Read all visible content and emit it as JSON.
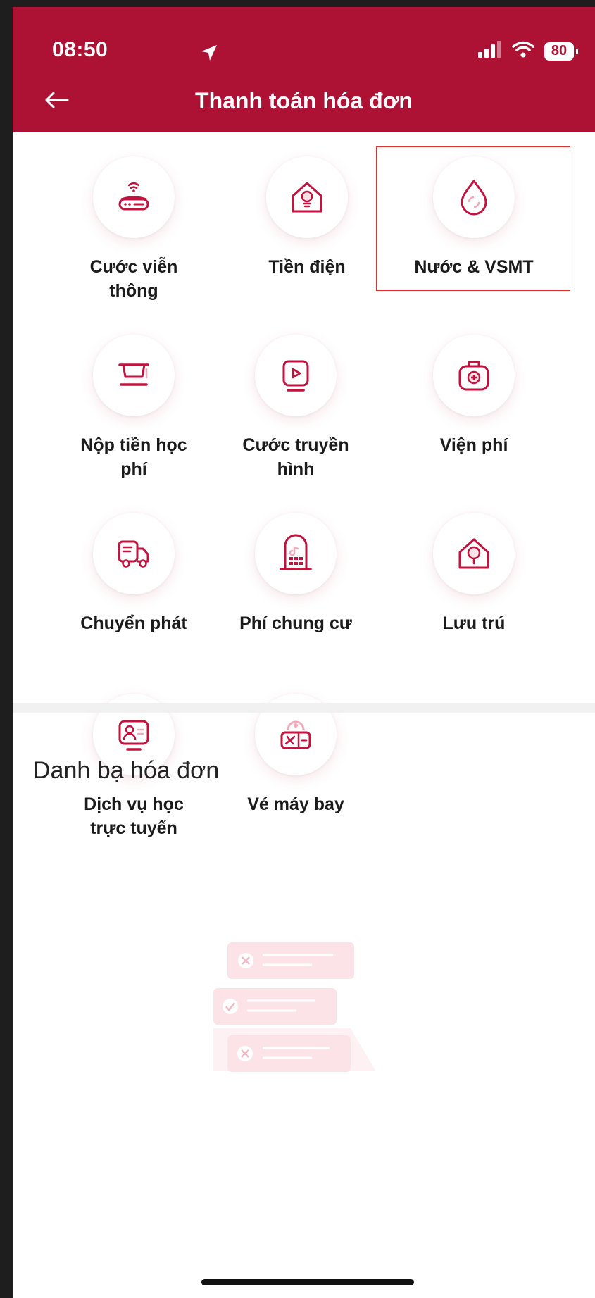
{
  "status_bar": {
    "time": "08:50",
    "battery": "80"
  },
  "header": {
    "title": "Thanh toán hóa đơn"
  },
  "services": [
    {
      "label_line1": "Cước viễn",
      "label_line2": "thông",
      "icon": "router-icon"
    },
    {
      "label_line1": "Tiền điện",
      "label_line2": "",
      "icon": "lightbulb-house-icon"
    },
    {
      "label_line1": "Nước & VSMT",
      "label_line2": "",
      "icon": "water-drop-icon"
    },
    {
      "label_line1": "Nộp tiền học",
      "label_line2": "phí",
      "icon": "graduation-cap-icon"
    },
    {
      "label_line1": "Cước truyền",
      "label_line2": "hình",
      "icon": "tv-icon"
    },
    {
      "label_line1": "Viện phí",
      "label_line2": "",
      "icon": "medical-bag-icon"
    },
    {
      "label_line1": "Chuyển phát",
      "label_line2": "",
      "icon": "delivery-truck-icon"
    },
    {
      "label_line1": "Phí chung cư",
      "label_line2": "",
      "icon": "apartment-building-icon"
    },
    {
      "label_line1": "Lưu trú",
      "label_line2": "",
      "icon": "house-tree-icon"
    },
    {
      "label_line1": "Dịch vụ học",
      "label_line2": "trực tuyến",
      "icon": "online-learning-icon"
    },
    {
      "label_line1": "Vé máy bay",
      "label_line2": "",
      "icon": "airplane-ticket-icon"
    }
  ],
  "bill_contacts": {
    "title": "Danh bạ hóa đơn"
  },
  "colors": {
    "brand": "#ad1134",
    "icon": "#c3123d",
    "highlight_border": "#e0312f"
  }
}
